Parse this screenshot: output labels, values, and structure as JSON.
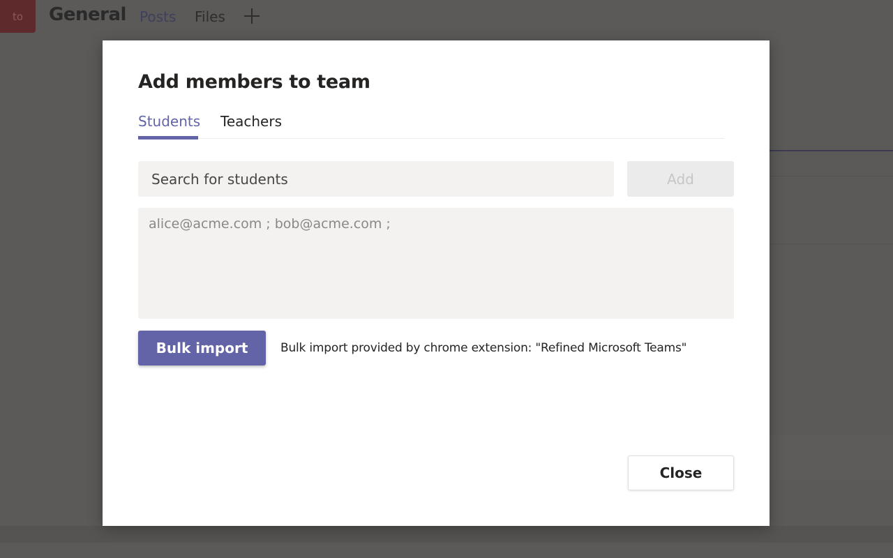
{
  "background": {
    "team_avatar_text": "to",
    "channel_title": "General",
    "tabs": [
      {
        "label": "Posts",
        "active": true
      },
      {
        "label": "Files",
        "active": false
      }
    ],
    "add_tab_icon": "plus-icon"
  },
  "dialog": {
    "title": "Add members to team",
    "tabs": [
      {
        "label": "Students",
        "active": true
      },
      {
        "label": "Teachers",
        "active": false
      }
    ],
    "search": {
      "placeholder": "Search for students",
      "value": ""
    },
    "add_button_label": "Add",
    "emails_field": {
      "placeholder": "alice@acme.com ; bob@acme.com ;",
      "value": ""
    },
    "bulk_import_label": "Bulk import",
    "bulk_note": "Bulk import provided by chrome extension: \"Refined Microsoft Teams\"",
    "close_label": "Close"
  },
  "colors": {
    "accent": "#6264a7",
    "overlay": "#5b5a58",
    "input_bg": "#f3f2f1",
    "disabled_bg": "#ebebeb",
    "disabled_text": "#c8c6c4"
  }
}
